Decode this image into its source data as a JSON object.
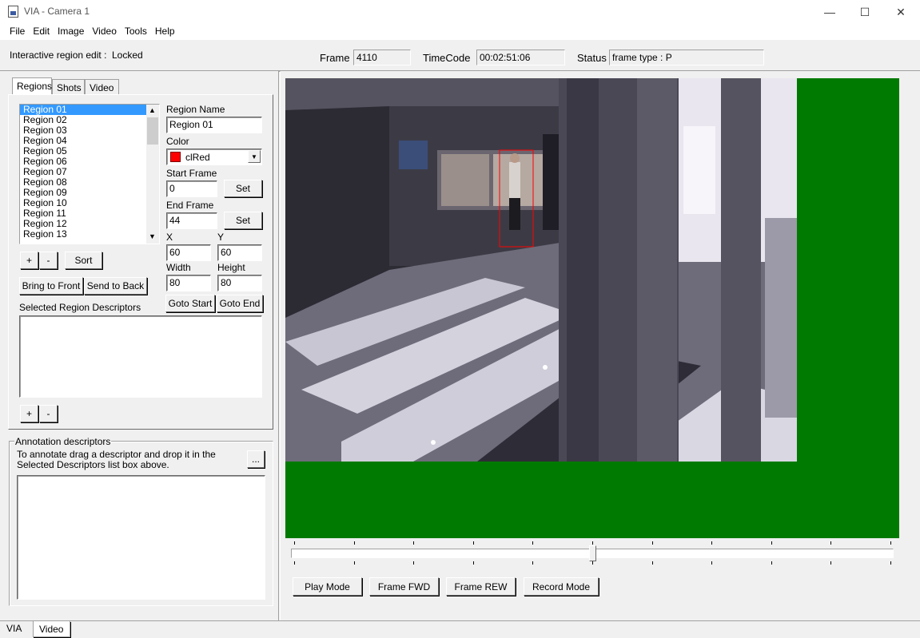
{
  "window": {
    "title": "VIA - Camera 1",
    "minimize_glyph": "—",
    "maximize_glyph": "☐",
    "close_glyph": "✕"
  },
  "menu": [
    "File",
    "Edit",
    "Image",
    "Video",
    "Tools",
    "Help"
  ],
  "status": {
    "edit_label": "Interactive region edit :",
    "edit_value": "Locked",
    "frame_label": "Frame",
    "frame_value": "4110",
    "timecode_label": "TimeCode",
    "timecode_value": "00:02:51:06",
    "status_label": "Status",
    "status_value": "frame type : P"
  },
  "tabs": {
    "regions": "Regions",
    "shots": "Shots",
    "video": "Video"
  },
  "regions": {
    "items": [
      "Region 01",
      "Region 02",
      "Region 03",
      "Region 04",
      "Region 05",
      "Region 06",
      "Region 07",
      "Region 08",
      "Region 09",
      "Region 10",
      "Region 11",
      "Region 12",
      "Region 13"
    ],
    "selected": "Region 01",
    "add_label": "+",
    "remove_label": "-",
    "sort_label": "Sort",
    "bring_front_label": "Bring to Front",
    "send_back_label": "Send to Back",
    "descriptors_label": "Selected Region Descriptors",
    "desc_add_label": "+",
    "desc_remove_label": "-"
  },
  "region_props": {
    "name_label": "Region Name",
    "name_value": "Region 01",
    "color_label": "Color",
    "color_value": "clRed",
    "color_swatch": "#ff0000",
    "start_label": "Start Frame",
    "start_value": "0",
    "end_label": "End Frame",
    "end_value": "44",
    "set_label": "Set",
    "x_label": "X",
    "x_value": "60",
    "y_label": "Y",
    "y_value": "60",
    "width_label": "Width",
    "width_value": "80",
    "height_label": "Height",
    "height_value": "80",
    "goto_start_label": "Goto Start",
    "goto_end_label": "Goto End"
  },
  "annotation": {
    "group_label": "Annotation descriptors",
    "hint": "To annotate drag a descriptor and drop it in the Selected Descriptors list box above.",
    "more_label": "..."
  },
  "video_controls": {
    "play": "Play Mode",
    "frame_fwd": "Frame FWD",
    "frame_rew": "Frame REW",
    "record": "Record Mode",
    "slider_position": 0.5
  },
  "bottom_tabs": [
    "VIA",
    "Video"
  ],
  "colors": {
    "canvas_green": "#007a00",
    "selection": "#3399ff",
    "region_box": "#ff0000"
  }
}
